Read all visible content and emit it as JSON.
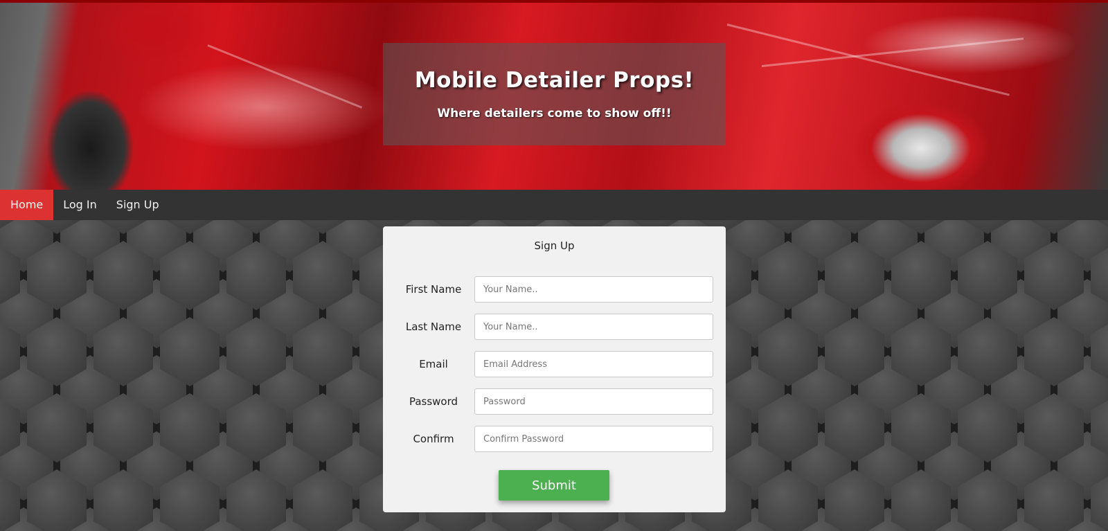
{
  "hero": {
    "title": "Mobile Detailer Props!",
    "subtitle": "Where detailers come to show off!!"
  },
  "nav": {
    "items": [
      {
        "label": "Home",
        "active": true
      },
      {
        "label": "Log In",
        "active": false
      },
      {
        "label": "Sign Up",
        "active": false
      }
    ]
  },
  "form": {
    "title": "Sign Up",
    "fields": [
      {
        "label": "First Name",
        "placeholder": "Your Name.."
      },
      {
        "label": "Last Name",
        "placeholder": "Your Name.."
      },
      {
        "label": "Email",
        "placeholder": "Email Address"
      },
      {
        "label": "Password",
        "placeholder": "Password"
      },
      {
        "label": "Confirm",
        "placeholder": "Confirm Password"
      }
    ],
    "submit_label": "Submit"
  },
  "colors": {
    "nav_bg": "#333333",
    "nav_active": "#dc3232",
    "submit_bg": "#4caf50",
    "card_bg": "#f1f1f1"
  }
}
